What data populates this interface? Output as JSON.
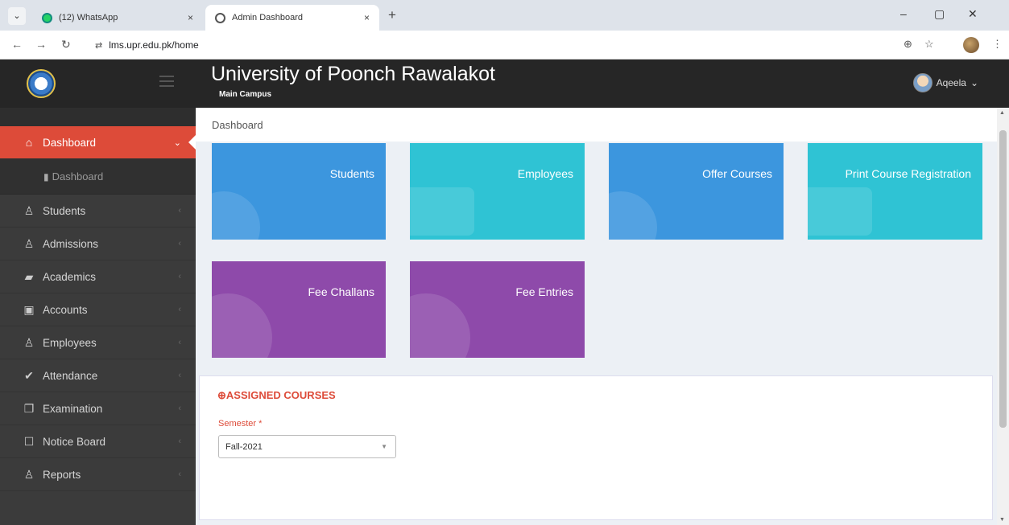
{
  "browser": {
    "tabs": [
      {
        "label": "(12) WhatsApp",
        "close": "×"
      },
      {
        "label": "Admin Dashboard",
        "close": "×"
      }
    ],
    "new_tab": "+",
    "window_controls": {
      "minimize": "–",
      "restore": "▢",
      "close": "✕"
    },
    "nav": {
      "back": "←",
      "forward": "→",
      "reload": "↻",
      "site_settings": "⇄"
    },
    "url": "lms.upr.edu.pk/home",
    "zoom_icon": "⊕",
    "star_icon": "☆",
    "menu_icon": "⋮",
    "tab_list_icon": "⌄"
  },
  "header": {
    "title": "University of Poonch Rawalakot",
    "subtitle": "Main Campus",
    "user_name": "Aqeela",
    "user_caret": "⌄"
  },
  "sidebar": {
    "items": [
      {
        "label": "Dashboard",
        "icon": "⌂",
        "arrow": "⌄"
      },
      {
        "label": "Students",
        "icon": "♙",
        "arrow": "‹"
      },
      {
        "label": "Admissions",
        "icon": "♙",
        "arrow": "‹"
      },
      {
        "label": "Academics",
        "icon": "▰",
        "arrow": "‹"
      },
      {
        "label": "Accounts",
        "icon": "▣",
        "arrow": "‹"
      },
      {
        "label": "Employees",
        "icon": "♙",
        "arrow": "‹"
      },
      {
        "label": "Attendance",
        "icon": "✔",
        "arrow": "‹"
      },
      {
        "label": "Examination",
        "icon": "❐",
        "arrow": "‹"
      },
      {
        "label": "Notice Board",
        "icon": "☐",
        "arrow": "‹"
      },
      {
        "label": "Reports",
        "icon": "♙",
        "arrow": "‹"
      }
    ],
    "sub_item": {
      "label": "Dashboard",
      "icon": "▮"
    }
  },
  "breadcrumb": "Dashboard",
  "tiles": [
    {
      "label": "Students",
      "color": "#3c96de"
    },
    {
      "label": "Employees",
      "color": "#2fc3d4"
    },
    {
      "label": "Offer Courses",
      "color": "#3c96de"
    },
    {
      "label": "Print Course Registration",
      "color": "#2fc3d4"
    },
    {
      "label": "Fee Challans",
      "color": "#8e4aaa"
    },
    {
      "label": "Fee Entries",
      "color": "#8e4aaa"
    }
  ],
  "assigned_courses": {
    "title": "ASSIGNED COURSES",
    "icon": "⊕",
    "semester_label": "Semester *",
    "semester_value": "Fall-2021"
  },
  "colors": {
    "accent": "#dd4b39",
    "topbar": "#262626",
    "sidebar": "#3b3b3b"
  }
}
